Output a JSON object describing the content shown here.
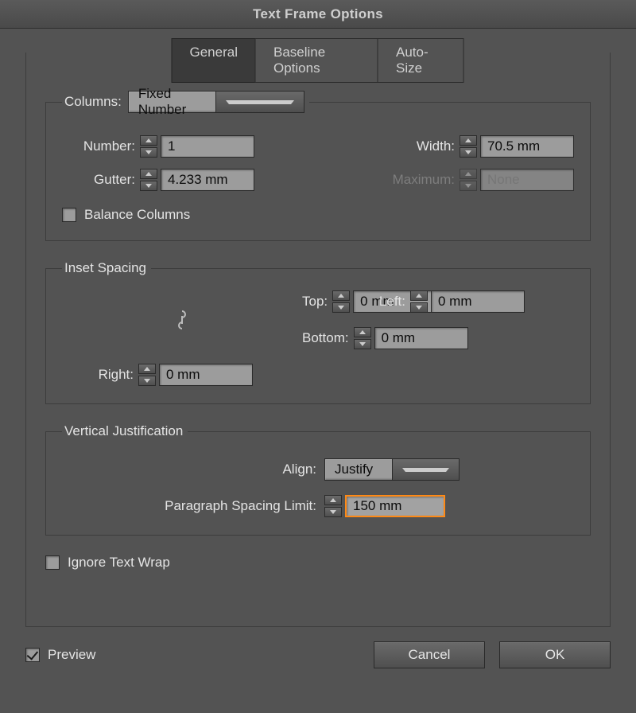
{
  "title": "Text Frame Options",
  "tabs": {
    "general": "General",
    "baseline": "Baseline Options",
    "auto": "Auto-Size",
    "active": "general"
  },
  "columns": {
    "legend": "Columns:",
    "type": "Fixed Number",
    "number_label": "Number:",
    "number_value": "1",
    "width_label": "Width:",
    "width_value": "70.5 mm",
    "gutter_label": "Gutter:",
    "gutter_value": "4.233 mm",
    "maximum_label": "Maximum:",
    "maximum_value": "None",
    "balance_label": "Balance Columns",
    "balance_checked": false
  },
  "inset": {
    "legend": "Inset Spacing",
    "top_label": "Top:",
    "top_value": "0 mm",
    "bottom_label": "Bottom:",
    "bottom_value": "0 mm",
    "left_label": "Left:",
    "left_value": "0 mm",
    "right_label": "Right:",
    "right_value": "0 mm"
  },
  "vjust": {
    "legend": "Vertical Justification",
    "align_label": "Align:",
    "align_value": "Justify",
    "limit_label": "Paragraph Spacing Limit:",
    "limit_value": "150 mm"
  },
  "ignore_wrap": {
    "label": "Ignore Text Wrap",
    "checked": false
  },
  "preview": {
    "label": "Preview",
    "checked": true
  },
  "buttons": {
    "cancel": "Cancel",
    "ok": "OK"
  }
}
